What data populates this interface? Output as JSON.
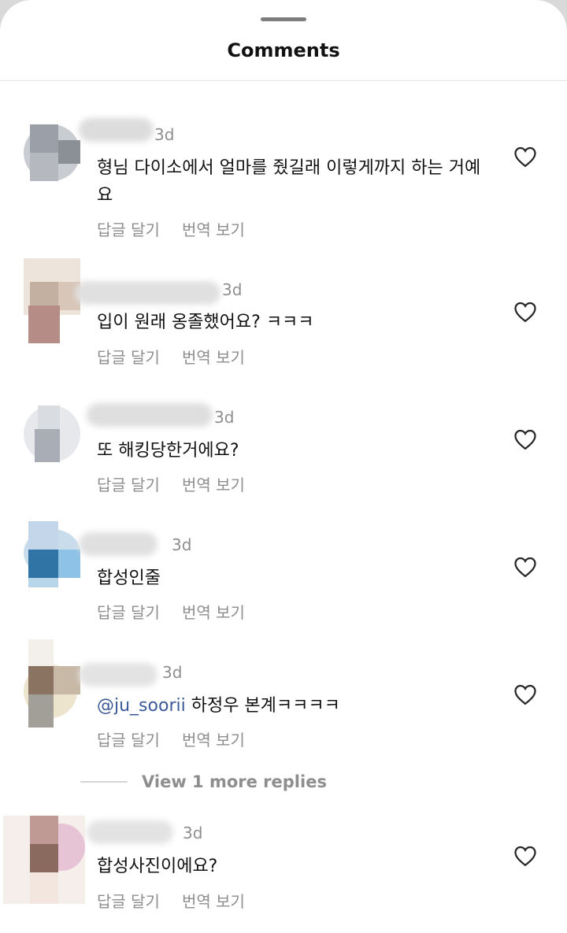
{
  "sheet": {
    "title": "Comments"
  },
  "comments": [
    {
      "time": "3d",
      "text": "형님 다이소에서 얼마를 줬길래 이렇게까지 하는 거예요",
      "reply": "답글 달기",
      "translate": "번역 보기"
    },
    {
      "time": "3d",
      "text": "입이 원래 옹졸했어요? ㅋㅋㅋ",
      "reply": "답글 달기",
      "translate": "번역 보기"
    },
    {
      "time": "3d",
      "text": "또 해킹당한거에요?",
      "reply": "답글 달기",
      "translate": "번역 보기"
    },
    {
      "time": "3d",
      "text": "합성인줄",
      "reply": "답글 달기",
      "translate": "번역 보기"
    },
    {
      "time": "3d",
      "mention": "@ju_soorii",
      "text": " 하정우 본계ㅋㅋㅋㅋ",
      "reply": "답글 달기",
      "translate": "번역 보기"
    },
    {
      "time": "3d",
      "text": "합성사진이에요?",
      "reply": "답글 달기",
      "translate": "번역 보기"
    }
  ],
  "view_replies": "View 1 more replies",
  "icons": {
    "heart": "heart-outline-icon",
    "handle": "drag-handle"
  }
}
